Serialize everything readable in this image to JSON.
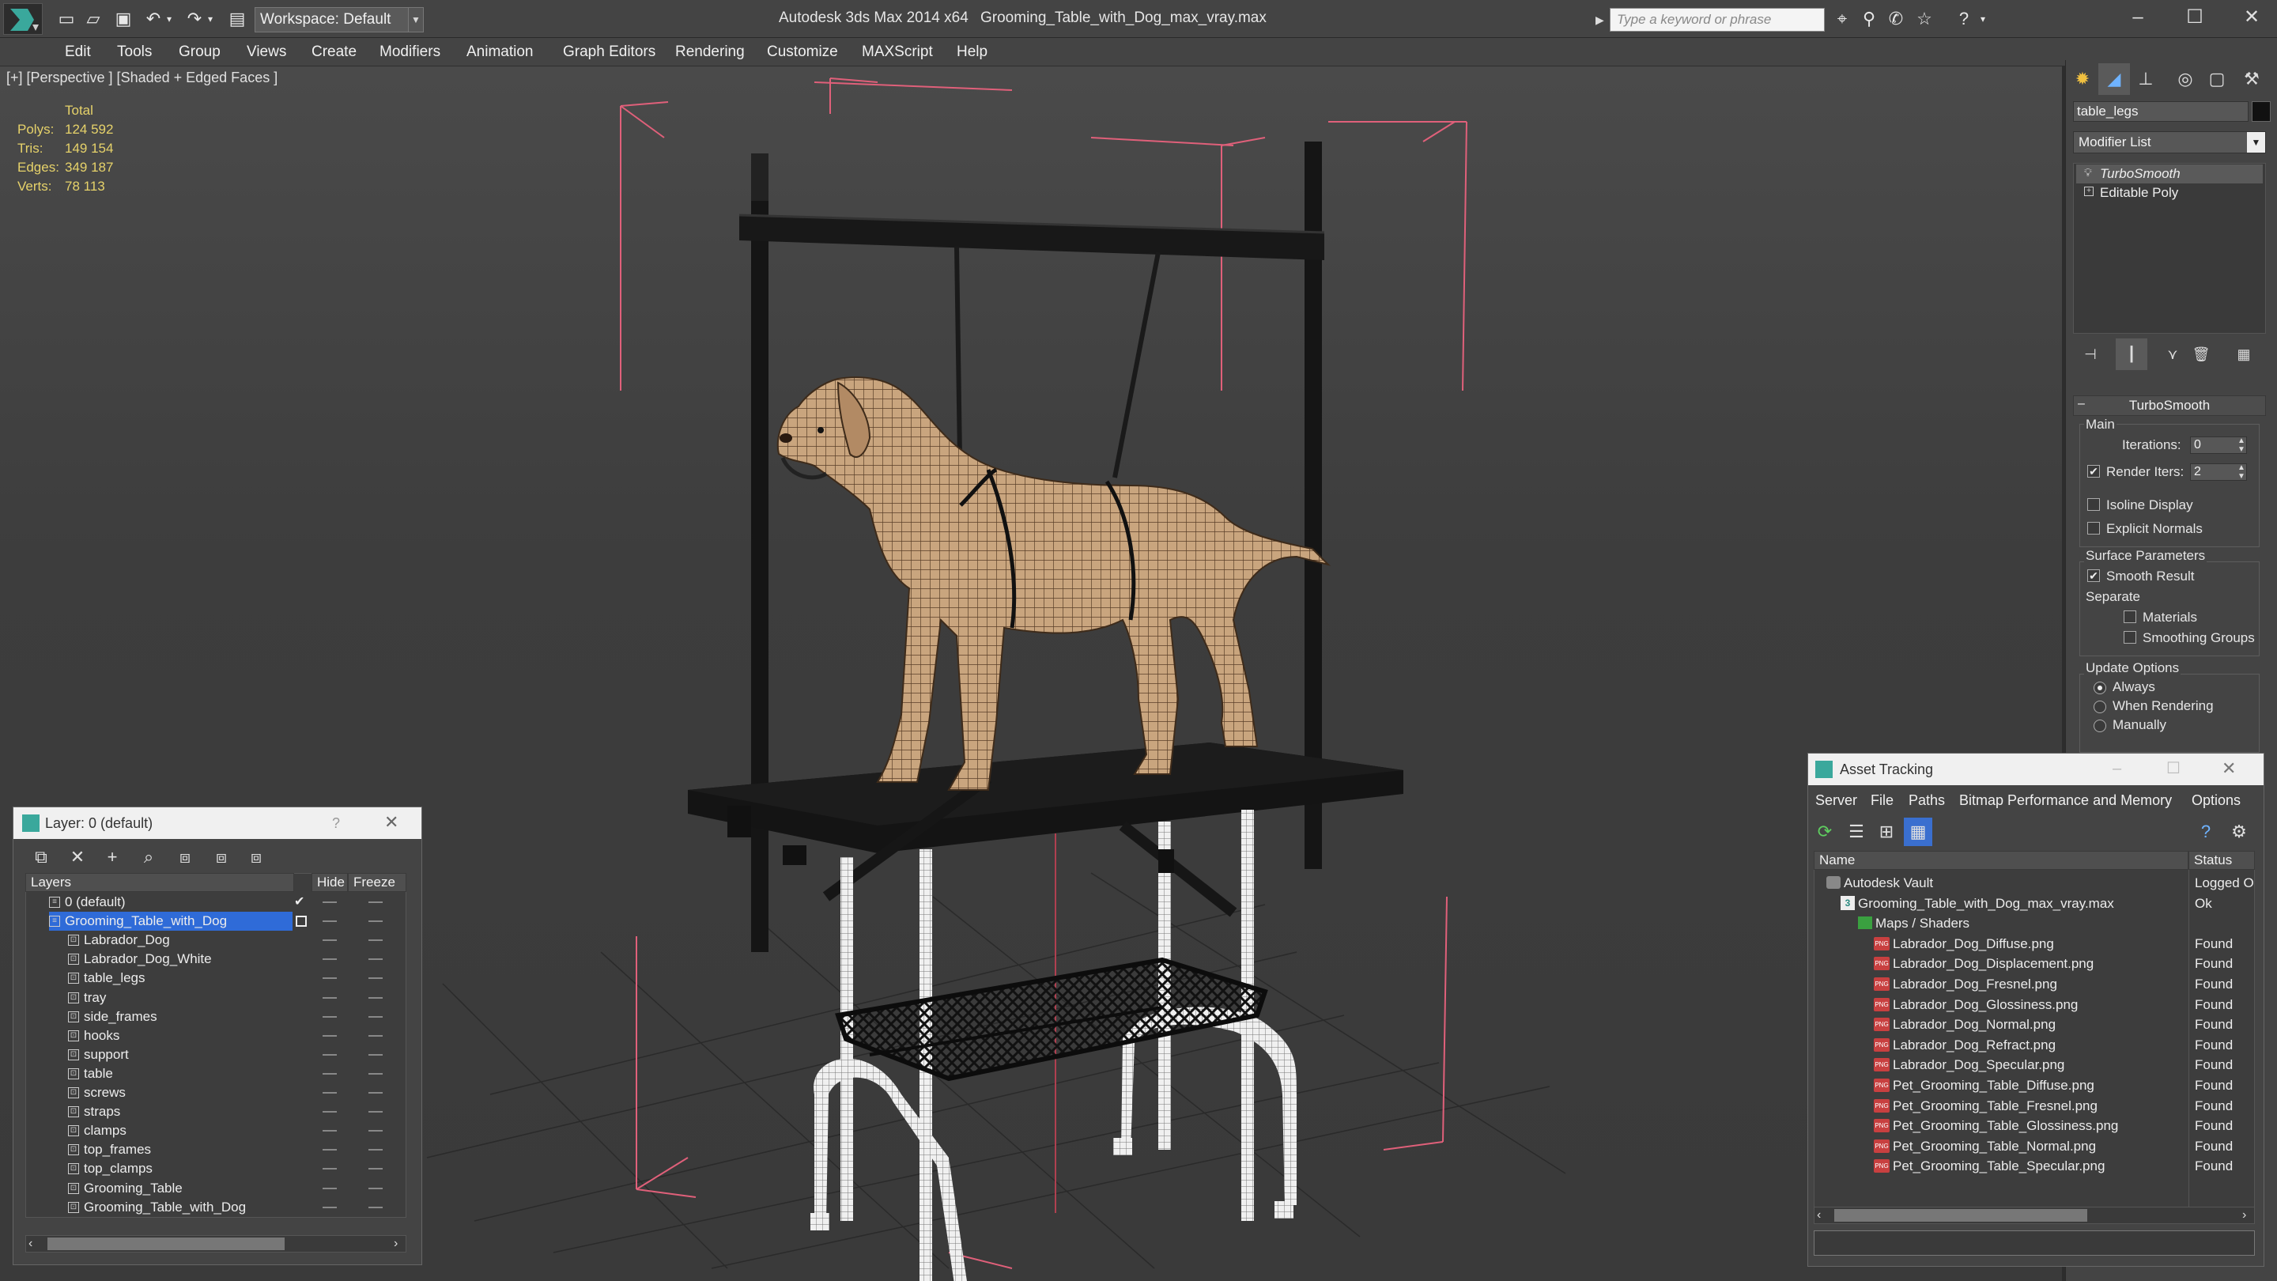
{
  "titlebar": {
    "workspace": "Workspace: Default",
    "app_title": "Autodesk 3ds Max  2014 x64",
    "file_title": "Grooming_Table_with_Dog_max_vray.max",
    "search_placeholder": "Type a keyword or phrase"
  },
  "menu": [
    "Edit",
    "Tools",
    "Group",
    "Views",
    "Create",
    "Modifiers",
    "Animation",
    "Graph Editors",
    "Rendering",
    "Customize",
    "MAXScript",
    "Help"
  ],
  "viewport": {
    "label": "[+] [Perspective ] [Shaded + Edged Faces ]",
    "stats_header": "Total",
    "stats": [
      {
        "label": "Polys:",
        "value": "124 592"
      },
      {
        "label": "Tris:",
        "value": "149 154"
      },
      {
        "label": "Edges:",
        "value": "349 187"
      },
      {
        "label": "Verts:",
        "value": "78 113"
      }
    ]
  },
  "command_panel": {
    "object_name": "table_legs",
    "modifier_list": "Modifier List",
    "stack": [
      "TurboSmooth",
      "Editable Poly"
    ],
    "rollout_title": "TurboSmooth",
    "main_label": "Main",
    "iterations_label": "Iterations:",
    "iterations_value": "0",
    "render_iters_label": "Render Iters:",
    "render_iters_value": "2",
    "isoline": "Isoline Display",
    "explicit_normals": "Explicit Normals",
    "surface_params": "Surface Parameters",
    "smooth_result": "Smooth Result",
    "separate": "Separate",
    "materials": "Materials",
    "smoothing_groups": "Smoothing Groups",
    "update_options": "Update Options",
    "always": "Always",
    "when_rendering": "When Rendering",
    "manually": "Manually"
  },
  "layer_window": {
    "title": "Layer: 0 (default)",
    "help": "?",
    "col_layers": "Layers",
    "col_hide": "Hide",
    "col_freeze": "Freeze",
    "rows": [
      {
        "name": "0 (default)"
      },
      {
        "name": "Grooming_Table_with_Dog"
      },
      {
        "name": "Labrador_Dog"
      },
      {
        "name": "Labrador_Dog_White"
      },
      {
        "name": "table_legs"
      },
      {
        "name": "tray"
      },
      {
        "name": "side_frames"
      },
      {
        "name": "hooks"
      },
      {
        "name": "support"
      },
      {
        "name": "table"
      },
      {
        "name": "screws"
      },
      {
        "name": "straps"
      },
      {
        "name": "clamps"
      },
      {
        "name": "top_frames"
      },
      {
        "name": "top_clamps"
      },
      {
        "name": "Grooming_Table"
      },
      {
        "name": "Grooming_Table_with_Dog"
      }
    ]
  },
  "asset_window": {
    "title": "Asset Tracking",
    "menu": [
      "Server",
      "File",
      "Paths",
      "Bitmap Performance and Memory",
      "Options"
    ],
    "col_name": "Name",
    "col_status": "Status",
    "rows": [
      {
        "name": "Autodesk Vault",
        "status": "Logged O"
      },
      {
        "name": "Grooming_Table_with_Dog_max_vray.max",
        "status": "Ok"
      },
      {
        "name": "Maps / Shaders",
        "status": ""
      },
      {
        "name": "Labrador_Dog_Diffuse.png",
        "status": "Found"
      },
      {
        "name": "Labrador_Dog_Displacement.png",
        "status": "Found"
      },
      {
        "name": "Labrador_Dog_Fresnel.png",
        "status": "Found"
      },
      {
        "name": "Labrador_Dog_Glossiness.png",
        "status": "Found"
      },
      {
        "name": "Labrador_Dog_Normal.png",
        "status": "Found"
      },
      {
        "name": "Labrador_Dog_Refract.png",
        "status": "Found"
      },
      {
        "name": "Labrador_Dog_Specular.png",
        "status": "Found"
      },
      {
        "name": "Pet_Grooming_Table_Diffuse.png",
        "status": "Found"
      },
      {
        "name": "Pet_Grooming_Table_Fresnel.png",
        "status": "Found"
      },
      {
        "name": "Pet_Grooming_Table_Glossiness.png",
        "status": "Found"
      },
      {
        "name": "Pet_Grooming_Table_Normal.png",
        "status": "Found"
      },
      {
        "name": "Pet_Grooming_Table_Specular.png",
        "status": "Found"
      }
    ]
  },
  "colors": {
    "selection": "#2f6bd8",
    "stats_text": "#e6d26a",
    "wire_pink": "#e0607a",
    "dog_fur": "#c8a27a"
  }
}
